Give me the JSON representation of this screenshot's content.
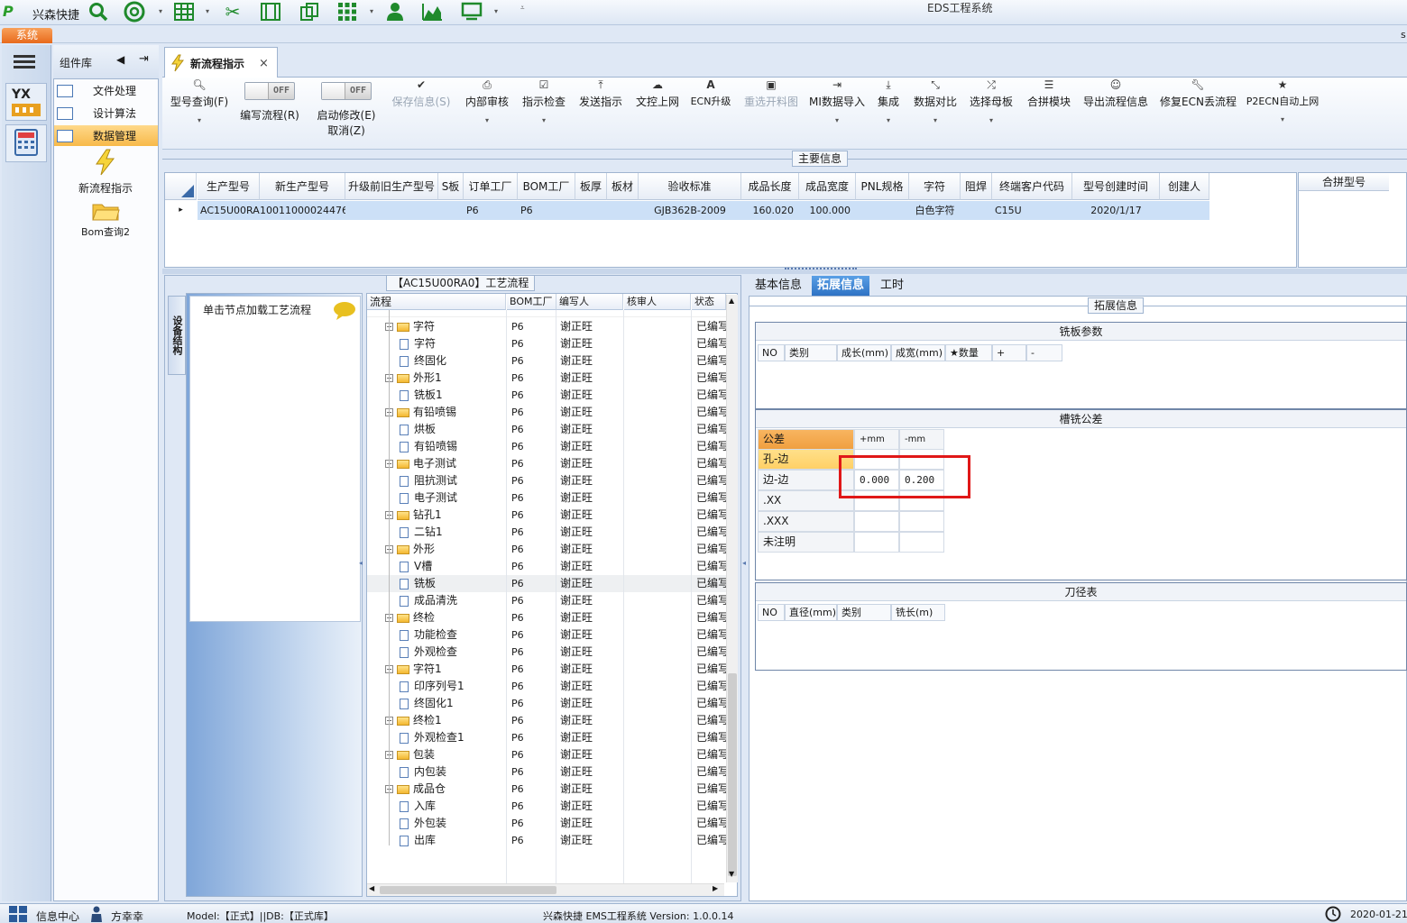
{
  "app": {
    "name": "兴森快捷",
    "window_title": "EDS工程系统",
    "system_tab": "系统",
    "right_edge_char": "s"
  },
  "component_panel": {
    "title": "组件库",
    "items": [
      {
        "label": "文件处理",
        "active": false
      },
      {
        "label": "设计算法",
        "active": false
      },
      {
        "label": "数据管理",
        "active": true
      }
    ],
    "tiles": [
      {
        "label": "新流程指示",
        "icon": "lightning-icon"
      },
      {
        "label": "Bom查询2",
        "icon": "folder-icon"
      }
    ]
  },
  "doc_tab": {
    "label": "新流程指示",
    "close": "×"
  },
  "ribbon": {
    "query": {
      "label": "型号查询(F)"
    },
    "edit_flow": {
      "label": "编写流程(R)",
      "toggle": "OFF"
    },
    "start_modify": {
      "label": "启动修改(E)",
      "label2": "取消(Z)",
      "toggle": "OFF"
    },
    "buttons": [
      {
        "label": "保存信息(S)",
        "disabled": true,
        "dropdown": false
      },
      {
        "label": "内部审核",
        "disabled": false,
        "dropdown": true
      },
      {
        "label": "指示检查",
        "disabled": false,
        "dropdown": true
      },
      {
        "label": "发送指示",
        "disabled": false,
        "dropdown": false
      },
      {
        "label": "文控上网",
        "disabled": false,
        "dropdown": false
      },
      {
        "label": "ECN升级",
        "disabled": false,
        "dropdown": false
      },
      {
        "label": "重选开料图",
        "disabled": true,
        "dropdown": false
      },
      {
        "label": "MI数据导入",
        "disabled": false,
        "dropdown": true
      },
      {
        "label": "集成",
        "disabled": false,
        "dropdown": true
      },
      {
        "label": "数据对比",
        "disabled": false,
        "dropdown": true
      },
      {
        "label": "选择母板",
        "disabled": false,
        "dropdown": true
      },
      {
        "label": "合拼模块",
        "disabled": false,
        "dropdown": false
      },
      {
        "label": "导出流程信息",
        "disabled": false,
        "dropdown": false
      },
      {
        "label": "修复ECN丢流程",
        "disabled": false,
        "dropdown": false
      },
      {
        "label": "P2ECN自动上网",
        "disabled": false,
        "dropdown": true
      }
    ]
  },
  "main_info": {
    "caption": "主要信息",
    "columns": [
      "生产型号",
      "新生产型号",
      "升级前旧生产型号",
      "S板",
      "订单工厂",
      "BOM工厂",
      "板厚",
      "板材",
      "验收标准",
      "成品长度",
      "成品宽度",
      "PNL规格",
      "字符",
      "阻焊",
      "终端客户代码",
      "型号创建时间",
      "创建人"
    ],
    "row": [
      "AC15U00RA0",
      "10011000024476",
      "",
      "",
      "P6",
      "P6",
      "",
      "",
      "GJB362B-2009",
      "160.020",
      "100.000",
      "",
      "白色字符",
      "",
      "C15U",
      "2020/1/17",
      ""
    ],
    "row_marker": "▸"
  },
  "merge_panel": {
    "title": "合拼型号"
  },
  "process": {
    "caption": "【AC15U00RA0】工艺流程",
    "side_tab": "设备结构",
    "load_hint": "单击节点加载工艺流程",
    "columns": [
      "流程",
      "BOM工厂",
      "编写人",
      "核审人",
      "状态"
    ],
    "rows": [
      {
        "name": "字符",
        "level": 0,
        "factory": "P6",
        "author": "谢正旺",
        "status": "已编写"
      },
      {
        "name": "字符",
        "level": 1,
        "factory": "P6",
        "author": "谢正旺",
        "status": "已编写"
      },
      {
        "name": "终固化",
        "level": 1,
        "factory": "P6",
        "author": "谢正旺",
        "status": "已编写"
      },
      {
        "name": "外形1",
        "level": 0,
        "factory": "P6",
        "author": "谢正旺",
        "status": "已编写"
      },
      {
        "name": "铣板1",
        "level": 1,
        "factory": "P6",
        "author": "谢正旺",
        "status": "已编写"
      },
      {
        "name": "有铅喷锡",
        "level": 0,
        "factory": "P6",
        "author": "谢正旺",
        "status": "已编写"
      },
      {
        "name": "烘板",
        "level": 1,
        "factory": "P6",
        "author": "谢正旺",
        "status": "已编写"
      },
      {
        "name": "有铅喷锡",
        "level": 1,
        "factory": "P6",
        "author": "谢正旺",
        "status": "已编写"
      },
      {
        "name": "电子测试",
        "level": 0,
        "factory": "P6",
        "author": "谢正旺",
        "status": "已编写"
      },
      {
        "name": "阻抗测试",
        "level": 1,
        "factory": "P6",
        "author": "谢正旺",
        "status": "已编写"
      },
      {
        "name": "电子测试",
        "level": 1,
        "factory": "P6",
        "author": "谢正旺",
        "status": "已编写"
      },
      {
        "name": "钻孔1",
        "level": 0,
        "factory": "P6",
        "author": "谢正旺",
        "status": "已编写"
      },
      {
        "name": "二钻1",
        "level": 1,
        "factory": "P6",
        "author": "谢正旺",
        "status": "已编写"
      },
      {
        "name": "外形",
        "level": 0,
        "factory": "P6",
        "author": "谢正旺",
        "status": "已编写"
      },
      {
        "name": "V槽",
        "level": 1,
        "factory": "P6",
        "author": "谢正旺",
        "status": "已编写"
      },
      {
        "name": "铣板",
        "level": 1,
        "factory": "P6",
        "author": "谢正旺",
        "status": "已编写",
        "selected": true
      },
      {
        "name": "成品清洗",
        "level": 1,
        "factory": "P6",
        "author": "谢正旺",
        "status": "已编写"
      },
      {
        "name": "终检",
        "level": 0,
        "factory": "P6",
        "author": "谢正旺",
        "status": "已编写"
      },
      {
        "name": "功能检查",
        "level": 1,
        "factory": "P6",
        "author": "谢正旺",
        "status": "已编写"
      },
      {
        "name": "外观检查",
        "level": 1,
        "factory": "P6",
        "author": "谢正旺",
        "status": "已编写"
      },
      {
        "name": "字符1",
        "level": 0,
        "factory": "P6",
        "author": "谢正旺",
        "status": "已编写"
      },
      {
        "name": "印序列号1",
        "level": 1,
        "factory": "P6",
        "author": "谢正旺",
        "status": "已编写"
      },
      {
        "name": "终固化1",
        "level": 1,
        "factory": "P6",
        "author": "谢正旺",
        "status": "已编写"
      },
      {
        "name": "终检1",
        "level": 0,
        "factory": "P6",
        "author": "谢正旺",
        "status": "已编写"
      },
      {
        "name": "外观检查1",
        "level": 1,
        "factory": "P6",
        "author": "谢正旺",
        "status": "已编写"
      },
      {
        "name": "包装",
        "level": 0,
        "factory": "P6",
        "author": "谢正旺",
        "status": "已编写"
      },
      {
        "name": "内包装",
        "level": 1,
        "factory": "P6",
        "author": "谢正旺",
        "status": "已编写"
      },
      {
        "name": "成品仓",
        "level": 0,
        "factory": "P6",
        "author": "谢正旺",
        "status": "已编写"
      },
      {
        "name": "入库",
        "level": 1,
        "factory": "P6",
        "author": "谢正旺",
        "status": "已编写"
      },
      {
        "name": "外包装",
        "level": 1,
        "factory": "P6",
        "author": "谢正旺",
        "status": "已编写"
      },
      {
        "name": "出库",
        "level": 1,
        "factory": "P6",
        "author": "谢正旺",
        "status": "已编写"
      }
    ]
  },
  "detail": {
    "tabs": [
      {
        "label": "基本信息",
        "active": false
      },
      {
        "label": "拓展信息",
        "active": true
      },
      {
        "label": "工时",
        "active": false
      }
    ],
    "caption": "拓展信息",
    "milling_params": {
      "title": "铣板参数",
      "columns": [
        "NO",
        "类别",
        "成长(mm)",
        "成宽(mm)",
        "★数量",
        "+",
        "-"
      ]
    },
    "slot_tolerance": {
      "title": "槽铣公差",
      "header": [
        "公差",
        "+mm",
        "-mm"
      ],
      "rows": [
        {
          "label": "孔-边",
          "plus": "",
          "minus": "",
          "active": true
        },
        {
          "label": "边-边",
          "plus": "0.000",
          "minus": "0.200",
          "active": false
        },
        {
          "label": ".XX",
          "plus": "",
          "minus": "",
          "active": false
        },
        {
          "label": ".XXX",
          "plus": "",
          "minus": "",
          "active": false
        },
        {
          "label": "未注明",
          "plus": "",
          "minus": "",
          "active": false
        }
      ]
    },
    "tool_table": {
      "title": "刀径表",
      "columns": [
        "NO",
        "直径(mm)",
        "类别",
        "铣长(m)"
      ]
    }
  },
  "status_bar": {
    "info_center": "信息中心",
    "user": "方幸幸",
    "model_db": "Model:【正式】||DB:【正式库】",
    "version": "兴森快捷 EMS工程系统 Version: 1.0.0.14",
    "date": "2020-01-21"
  },
  "colors": {
    "accent": "#2e72c4",
    "highlight": "#f0a040",
    "selection": "#cce0f7",
    "annotation": "#e01818"
  }
}
